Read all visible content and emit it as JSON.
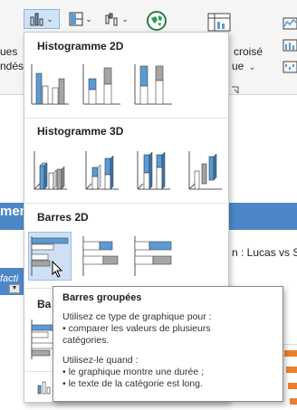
{
  "ribbon": {
    "left_fragment_1": "ues",
    "left_fragment_2": "ndés",
    "croise_label": "croisé",
    "ue_label": "ue",
    "chevron": "⌄",
    "icons": [
      "bar-chart-icon",
      "column-chart-icon",
      "waterfall-chart-icon",
      "map-chart-icon",
      "pivot-chart-icon",
      "sparkline-icon"
    ]
  },
  "sheet": {
    "left_band_text": "men",
    "filter_text": "facti",
    "right_label": "n : Lucas vs Se",
    "letter_b": "Ba"
  },
  "gallery": {
    "sections": [
      {
        "title": "Histogramme 2D"
      },
      {
        "title": "Histogramme 3D"
      },
      {
        "title": "Barres 2D"
      }
    ],
    "charts_2d": [
      "clustered-column-icon",
      "stacked-column-icon",
      "100-stacked-column-icon"
    ],
    "charts_3d": [
      "3d-clustered-column-icon",
      "3d-stacked-column-icon",
      "3d-100-stacked-column-icon",
      "3d-column-icon"
    ],
    "bars_2d": [
      "clustered-bar-icon",
      "stacked-bar-icon",
      "100-stacked-bar-icon"
    ]
  },
  "tooltip": {
    "title": "Barres groupées",
    "line1": "Utilisez ce type de graphique pour :",
    "line2": "• comparer les valeurs de plusieurs",
    "line3": "catégories.",
    "line4": "Utilisez-le quand :",
    "line5": "• le graphique montre une durée ;",
    "line6": "• le texte de la catégorie est long."
  },
  "colors": {
    "accent_blue": "#5b9bd5",
    "bar_grey": "#a5a5a5",
    "sheet_blue": "#4c88c8",
    "orange": "#ee7f2d",
    "selection": "#cfe0f4"
  }
}
